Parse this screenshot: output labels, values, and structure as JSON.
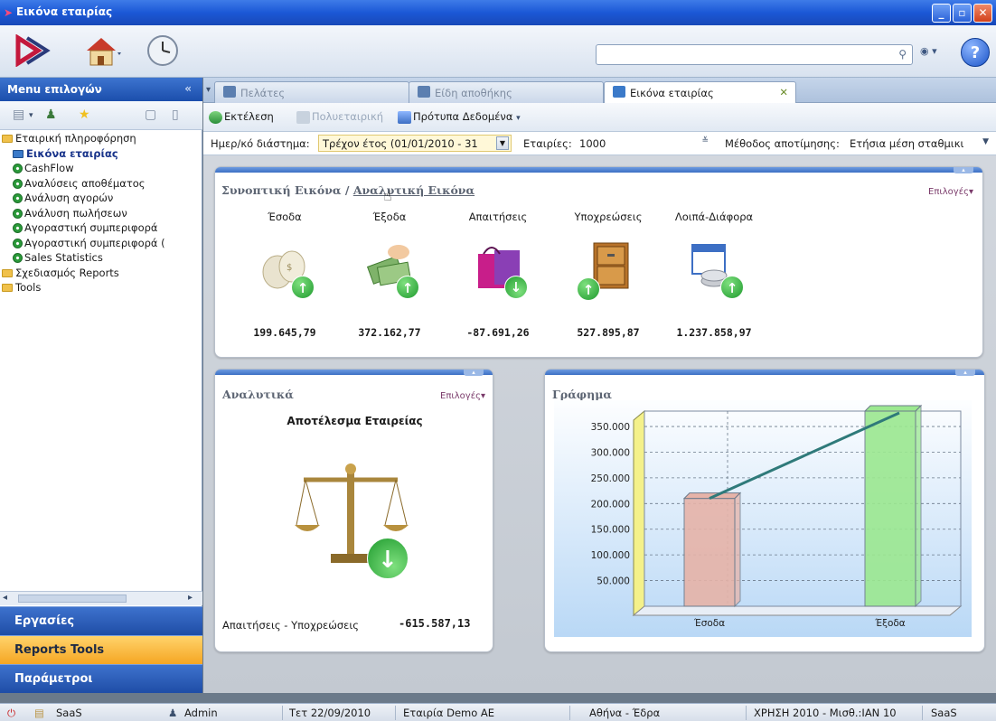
{
  "window": {
    "title": "Εικόνα εταιρίας"
  },
  "left_panel": {
    "header": "Menu επιλογών",
    "tree": [
      {
        "label": "Εταιρική πληροφόρηση",
        "kind": "folder"
      },
      {
        "label": "Εικόνα εταιρίας",
        "kind": "selected"
      },
      {
        "label": "CashFlow",
        "kind": "item"
      },
      {
        "label": "Αναλύσεις αποθέματος",
        "kind": "item"
      },
      {
        "label": "Ανάλυση αγορών",
        "kind": "item"
      },
      {
        "label": "Ανάλυση πωλήσεων",
        "kind": "item"
      },
      {
        "label": "Αγοραστική συμπεριφορά",
        "kind": "item"
      },
      {
        "label": "Αγοραστική συμπεριφορά (",
        "kind": "item"
      },
      {
        "label": "Sales Statistics",
        "kind": "item"
      },
      {
        "label": "Σχεδιασμός Reports",
        "kind": "folder"
      },
      {
        "label": "Tools",
        "kind": "folder"
      }
    ],
    "nav": [
      "Εργασίες",
      "Reports Tools",
      "Παράμετροι"
    ]
  },
  "tabs": [
    {
      "label": "Πελάτες"
    },
    {
      "label": "Είδη αποθήκης"
    },
    {
      "label": "Εικόνα εταιρίας"
    }
  ],
  "actions": {
    "run": "Εκτέλεση",
    "multi": "Πολυεταιρική",
    "templates": "Πρότυπα Δεδομένα"
  },
  "filters": {
    "period_label": "Ημερ/κό διάστημα:",
    "period_value": "Τρέχον έτος (01/01/2010 - 31",
    "companies_label": "Εταιρίες:",
    "companies_value": "1000",
    "valuation_label": "Μέθοδος αποτίμησης:",
    "valuation_value": "Ετήσια μέση σταθμικι"
  },
  "summary": {
    "title_main": "Συνοπτική Εικόνα",
    "title_sep": "/",
    "title_link": "Αναλυτική Εικόνα",
    "options": "Επιλογές",
    "kpis": [
      {
        "label": "Έσοδα",
        "value": "199.645,79"
      },
      {
        "label": "Έξοδα",
        "value": "372.162,77"
      },
      {
        "label": "Απαιτήσεις",
        "value": "-87.691,26"
      },
      {
        "label": "Υποχρεώσεις",
        "value": "527.895,87"
      },
      {
        "label": "Λοιπά-Διάφορα",
        "value": "1.237.858,97"
      }
    ]
  },
  "analytic": {
    "title": "Αναλυτικά",
    "options": "Επιλογές",
    "heading": "Αποτέλεσμα Εταιρείας",
    "result_label": "Απαιτήσεις - Υποχρεώσεις",
    "result_value": "-615.587,13"
  },
  "chart_panel": {
    "title": "Γράφημα"
  },
  "chart_data": {
    "type": "bar",
    "categories": [
      "Έσοδα",
      "Έξοδα"
    ],
    "values": [
      210000,
      380000
    ],
    "ylim": [
      0,
      380000
    ],
    "yticks": [
      "50.000",
      "100.000",
      "150.000",
      "200.000",
      "250.000",
      "300.000",
      "350.000"
    ],
    "ytick_values": [
      50000,
      100000,
      150000,
      200000,
      250000,
      300000,
      350000
    ],
    "bar_colors": [
      "#e6b3a8",
      "#9be890"
    ],
    "grid": true,
    "legend": "none"
  },
  "statusbar": {
    "app": "SaaS",
    "user": "Admin",
    "date": "Τετ 22/09/2010",
    "company": "Εταιρία Demo AE",
    "branch": "Αθήνα - Έδρα",
    "period": "ΧΡΗΣΗ 2010 - Μισθ.:ΙΑΝ 10",
    "mode": "SaaS"
  }
}
